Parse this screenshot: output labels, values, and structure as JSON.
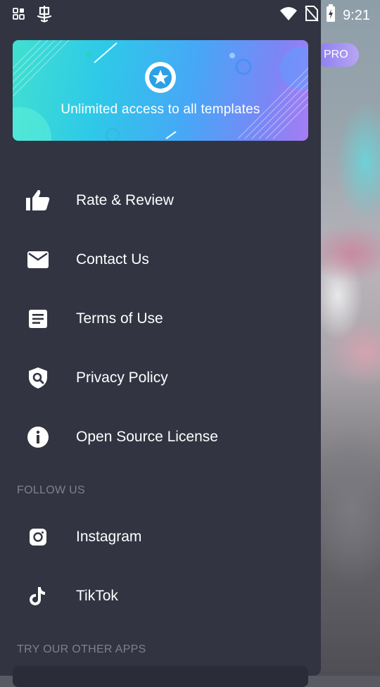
{
  "status_bar": {
    "time": "9:21"
  },
  "banner": {
    "text": "Unlimited access to all templates"
  },
  "background": {
    "pro_label": "PRO"
  },
  "menu": [
    {
      "label": "Rate & Review",
      "icon": "thumbs-up-icon"
    },
    {
      "label": "Contact Us",
      "icon": "envelope-icon"
    },
    {
      "label": "Terms of Use",
      "icon": "document-icon"
    },
    {
      "label": "Privacy Policy",
      "icon": "shield-search-icon"
    },
    {
      "label": "Open Source License",
      "icon": "info-icon"
    }
  ],
  "follow_section": {
    "title": "FOLLOW US",
    "items": [
      {
        "label": "Instagram",
        "icon": "instagram-icon"
      },
      {
        "label": "TikTok",
        "icon": "tiktok-icon"
      }
    ]
  },
  "other_apps_section": {
    "title": "TRY OUR OTHER APPS"
  },
  "colors": {
    "drawer_bg": "#323442",
    "section_text": "#7e8090",
    "pro_pill": "#8a7cf0"
  }
}
